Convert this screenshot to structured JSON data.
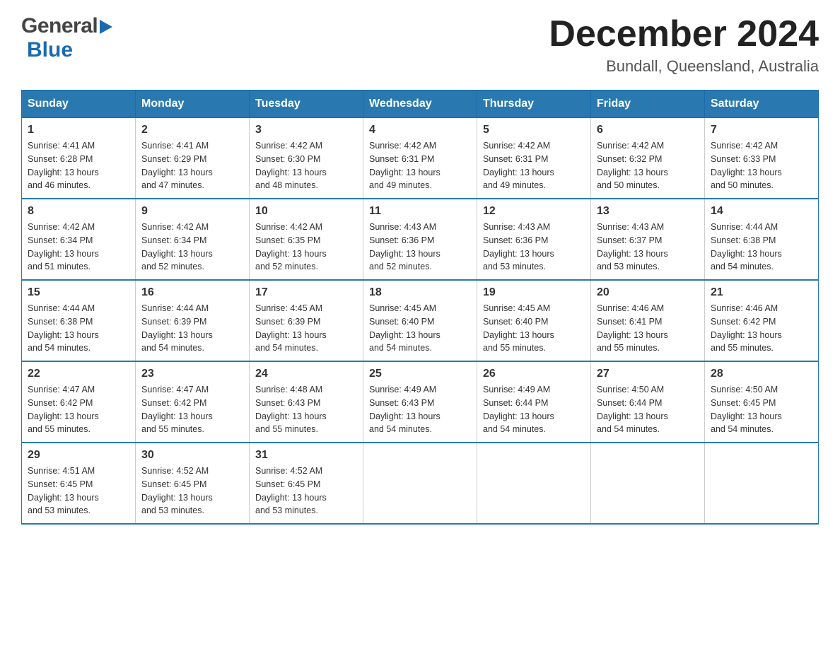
{
  "header": {
    "logo_general": "General",
    "logo_blue": "Blue",
    "title": "December 2024",
    "subtitle": "Bundall, Queensland, Australia"
  },
  "days_of_week": [
    "Sunday",
    "Monday",
    "Tuesday",
    "Wednesday",
    "Thursday",
    "Friday",
    "Saturday"
  ],
  "weeks": [
    [
      {
        "day": "1",
        "sunrise": "4:41 AM",
        "sunset": "6:28 PM",
        "daylight": "13 hours and 46 minutes."
      },
      {
        "day": "2",
        "sunrise": "4:41 AM",
        "sunset": "6:29 PM",
        "daylight": "13 hours and 47 minutes."
      },
      {
        "day": "3",
        "sunrise": "4:42 AM",
        "sunset": "6:30 PM",
        "daylight": "13 hours and 48 minutes."
      },
      {
        "day": "4",
        "sunrise": "4:42 AM",
        "sunset": "6:31 PM",
        "daylight": "13 hours and 49 minutes."
      },
      {
        "day": "5",
        "sunrise": "4:42 AM",
        "sunset": "6:31 PM",
        "daylight": "13 hours and 49 minutes."
      },
      {
        "day": "6",
        "sunrise": "4:42 AM",
        "sunset": "6:32 PM",
        "daylight": "13 hours and 50 minutes."
      },
      {
        "day": "7",
        "sunrise": "4:42 AM",
        "sunset": "6:33 PM",
        "daylight": "13 hours and 50 minutes."
      }
    ],
    [
      {
        "day": "8",
        "sunrise": "4:42 AM",
        "sunset": "6:34 PM",
        "daylight": "13 hours and 51 minutes."
      },
      {
        "day": "9",
        "sunrise": "4:42 AM",
        "sunset": "6:34 PM",
        "daylight": "13 hours and 52 minutes."
      },
      {
        "day": "10",
        "sunrise": "4:42 AM",
        "sunset": "6:35 PM",
        "daylight": "13 hours and 52 minutes."
      },
      {
        "day": "11",
        "sunrise": "4:43 AM",
        "sunset": "6:36 PM",
        "daylight": "13 hours and 52 minutes."
      },
      {
        "day": "12",
        "sunrise": "4:43 AM",
        "sunset": "6:36 PM",
        "daylight": "13 hours and 53 minutes."
      },
      {
        "day": "13",
        "sunrise": "4:43 AM",
        "sunset": "6:37 PM",
        "daylight": "13 hours and 53 minutes."
      },
      {
        "day": "14",
        "sunrise": "4:44 AM",
        "sunset": "6:38 PM",
        "daylight": "13 hours and 54 minutes."
      }
    ],
    [
      {
        "day": "15",
        "sunrise": "4:44 AM",
        "sunset": "6:38 PM",
        "daylight": "13 hours and 54 minutes."
      },
      {
        "day": "16",
        "sunrise": "4:44 AM",
        "sunset": "6:39 PM",
        "daylight": "13 hours and 54 minutes."
      },
      {
        "day": "17",
        "sunrise": "4:45 AM",
        "sunset": "6:39 PM",
        "daylight": "13 hours and 54 minutes."
      },
      {
        "day": "18",
        "sunrise": "4:45 AM",
        "sunset": "6:40 PM",
        "daylight": "13 hours and 54 minutes."
      },
      {
        "day": "19",
        "sunrise": "4:45 AM",
        "sunset": "6:40 PM",
        "daylight": "13 hours and 55 minutes."
      },
      {
        "day": "20",
        "sunrise": "4:46 AM",
        "sunset": "6:41 PM",
        "daylight": "13 hours and 55 minutes."
      },
      {
        "day": "21",
        "sunrise": "4:46 AM",
        "sunset": "6:42 PM",
        "daylight": "13 hours and 55 minutes."
      }
    ],
    [
      {
        "day": "22",
        "sunrise": "4:47 AM",
        "sunset": "6:42 PM",
        "daylight": "13 hours and 55 minutes."
      },
      {
        "day": "23",
        "sunrise": "4:47 AM",
        "sunset": "6:42 PM",
        "daylight": "13 hours and 55 minutes."
      },
      {
        "day": "24",
        "sunrise": "4:48 AM",
        "sunset": "6:43 PM",
        "daylight": "13 hours and 55 minutes."
      },
      {
        "day": "25",
        "sunrise": "4:49 AM",
        "sunset": "6:43 PM",
        "daylight": "13 hours and 54 minutes."
      },
      {
        "day": "26",
        "sunrise": "4:49 AM",
        "sunset": "6:44 PM",
        "daylight": "13 hours and 54 minutes."
      },
      {
        "day": "27",
        "sunrise": "4:50 AM",
        "sunset": "6:44 PM",
        "daylight": "13 hours and 54 minutes."
      },
      {
        "day": "28",
        "sunrise": "4:50 AM",
        "sunset": "6:45 PM",
        "daylight": "13 hours and 54 minutes."
      }
    ],
    [
      {
        "day": "29",
        "sunrise": "4:51 AM",
        "sunset": "6:45 PM",
        "daylight": "13 hours and 53 minutes."
      },
      {
        "day": "30",
        "sunrise": "4:52 AM",
        "sunset": "6:45 PM",
        "daylight": "13 hours and 53 minutes."
      },
      {
        "day": "31",
        "sunrise": "4:52 AM",
        "sunset": "6:45 PM",
        "daylight": "13 hours and 53 minutes."
      },
      null,
      null,
      null,
      null
    ]
  ],
  "labels": {
    "sunrise": "Sunrise:",
    "sunset": "Sunset:",
    "daylight": "Daylight:"
  }
}
